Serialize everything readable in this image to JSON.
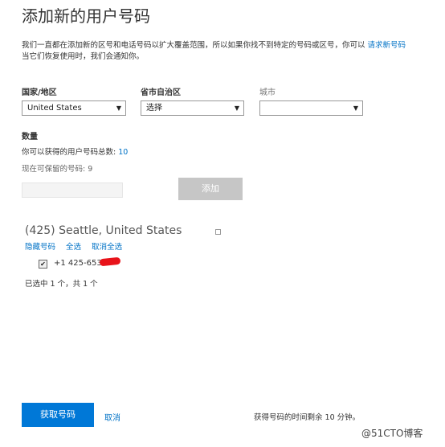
{
  "page": {
    "title": "添加新的用户号码",
    "description_text": "我们一直都在添加新的区号和电话号码以扩大覆盖范围，所以如果你找不到特定的号码或区号，你可以",
    "description_link": "请求新号码",
    "description_tail": "当它们恢复使用时，我们会通知你。"
  },
  "form": {
    "country_label": "国家/地区",
    "country_value": "United States",
    "state_label": "省市自治区",
    "state_value": "选择",
    "city_label": "城市",
    "city_value": "",
    "quantity_label": "数量",
    "total_text": "你可以获得的用户号码总数:",
    "total_value": "10",
    "reserve_text": "现在可保留的号码: 9",
    "quantity_input_value": "",
    "add_button": "添加"
  },
  "results": {
    "group_title": "(425) Seattle, United States",
    "hide_link": "隐藏号码",
    "select_all_link": "全选",
    "deselect_all_link": "取消全选",
    "numbers": [
      {
        "number": "+1 425-653-",
        "checked": true
      }
    ],
    "summary": "已选中 1 个，共 1 个"
  },
  "footer": {
    "get_button": "获取号码",
    "cancel_link": "取消",
    "timer_text": "获得号码的时间剩余 10 分钟。"
  },
  "watermark": "@51CTO博客",
  "colors": {
    "accent": "#0078d7",
    "link": "#0072c6",
    "disabled_button": "#c6c6c6"
  }
}
